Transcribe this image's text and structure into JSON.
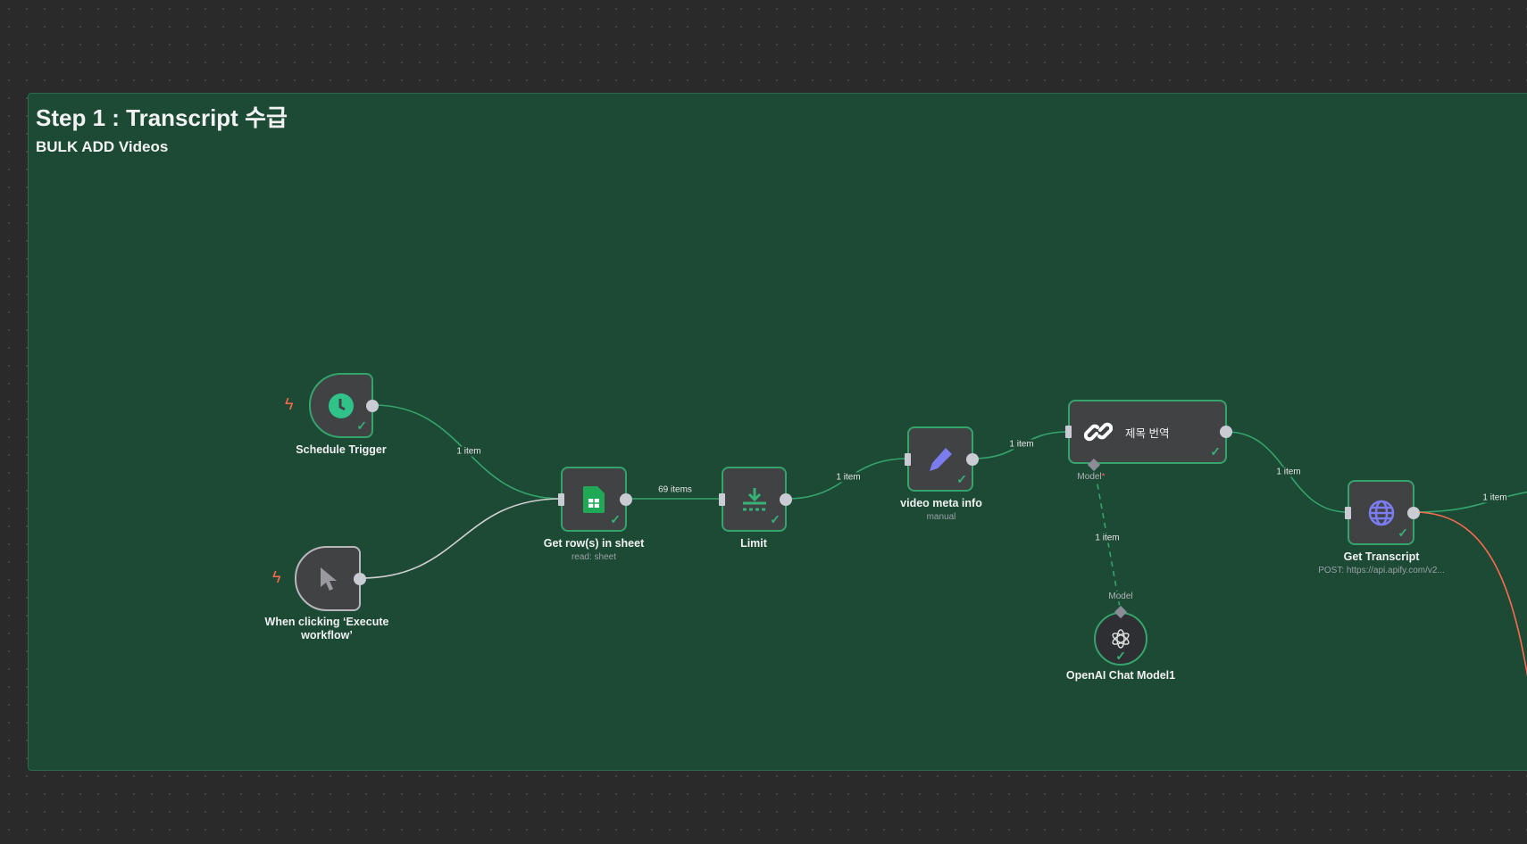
{
  "group": {
    "title": "Step 1 : Transcript 수급",
    "subtitle": "BULK ADD Videos"
  },
  "colors": {
    "accent": "#35a46c",
    "group_bg": "#1c4a35",
    "error_edge": "#ff6a4d",
    "manual_edge": "#d0d0d0"
  },
  "nodes": {
    "schedule": {
      "label": "Schedule Trigger",
      "icon": "clock-icon"
    },
    "manual": {
      "label": "When clicking ‘Execute workflow’",
      "icon": "cursor-icon"
    },
    "getrows": {
      "label": "Get row(s) in sheet",
      "sub": "read: sheet",
      "icon": "google-sheets-icon"
    },
    "limit": {
      "label": "Limit",
      "icon": "limit-icon"
    },
    "vmi": {
      "label": "video meta info",
      "sub": "manual",
      "icon": "pencil-icon"
    },
    "title": {
      "label": "제목 번역",
      "icon": "chain-link-icon",
      "port": "Model",
      "required": "*"
    },
    "transcript": {
      "label": "Get Transcript",
      "sub": "POST: https://api.apify.com/v2...",
      "icon": "globe-icon"
    },
    "openai": {
      "label": "OpenAI Chat Model1",
      "icon": "openai-icon",
      "port": "Model"
    }
  },
  "edges": [
    "1 item",
    "69 items",
    "1 item",
    "1 item",
    "1 item",
    "1 item",
    "1 item"
  ]
}
